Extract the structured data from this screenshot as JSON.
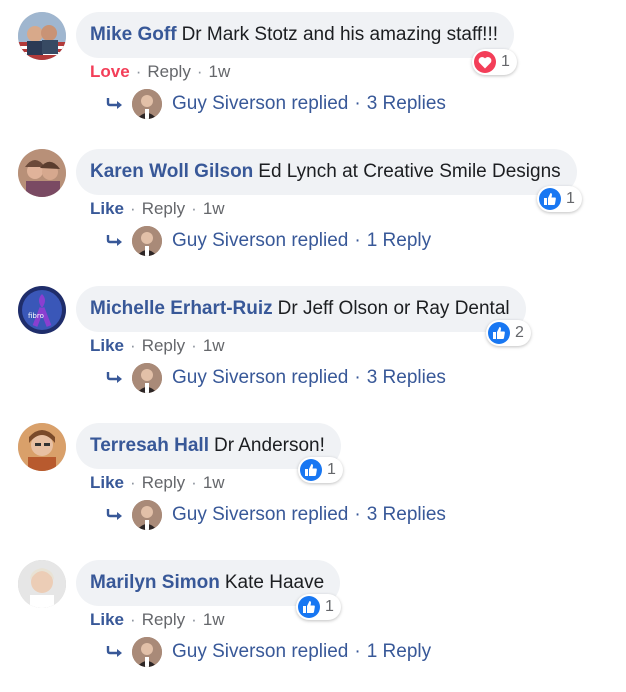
{
  "comments": [
    {
      "author": "Mike Goff",
      "text": "Dr Mark Stotz and his amazing staff!!!",
      "reaction_type": "love",
      "reaction_count": "1",
      "action_label": "Love",
      "reply_label": "Reply",
      "time": "1w",
      "replier": "Guy Siverson replied",
      "reply_count": "3 Replies"
    },
    {
      "author": "Karen Woll Gilson",
      "text": "Ed Lynch at Creative Smile Designs",
      "reaction_type": "like",
      "reaction_count": "1",
      "action_label": "Like",
      "reply_label": "Reply",
      "time": "1w",
      "replier": "Guy Siverson replied",
      "reply_count": "1 Reply"
    },
    {
      "author": "Michelle Erhart-Ruiz",
      "text": "Dr Jeff Olson or Ray Dental",
      "reaction_type": "like",
      "reaction_count": "2",
      "action_label": "Like",
      "reply_label": "Reply",
      "time": "1w",
      "replier": "Guy Siverson replied",
      "reply_count": "3 Replies"
    },
    {
      "author": "Terresah Hall",
      "text": "Dr Anderson!",
      "reaction_type": "like",
      "reaction_count": "1",
      "action_label": "Like",
      "reply_label": "Reply",
      "time": "1w",
      "replier": "Guy Siverson replied",
      "reply_count": "3 Replies"
    },
    {
      "author": "Marilyn Simon",
      "text": "Kate Haave",
      "reaction_type": "like",
      "reaction_count": "1",
      "action_label": "Like",
      "reply_label": "Reply",
      "time": "1w",
      "replier": "Guy Siverson replied",
      "reply_count": "1 Reply"
    }
  ],
  "separator": "·",
  "colors": {
    "link": "#385898",
    "like": "#1877f2",
    "love": "#f33e58",
    "bubble": "#f0f2f5",
    "meta": "#65676b"
  }
}
